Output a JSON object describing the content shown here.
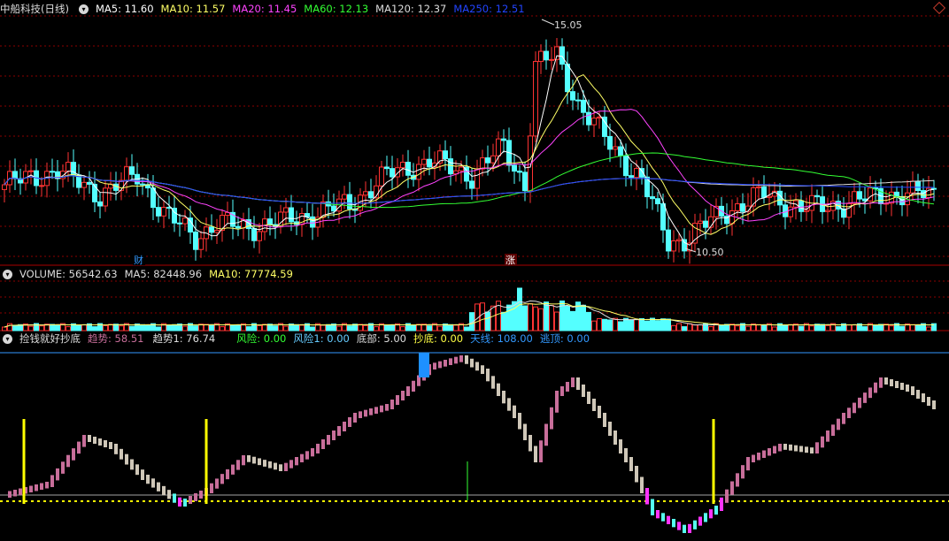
{
  "main_panel": {
    "stock_name": "中船科技",
    "period": "(日线)",
    "indicators": [
      {
        "label": "MA5: 11.60",
        "color": "#ffffff"
      },
      {
        "label": "MA10: 11.57",
        "color": "#ffff66"
      },
      {
        "label": "MA20: 11.45",
        "color": "#ff44ff"
      },
      {
        "label": "MA60: 12.13",
        "color": "#33ff33"
      },
      {
        "label": "MA120: 12.37",
        "color": "#dddddd"
      },
      {
        "label": "MA250: 12.51",
        "color": "#2244ff"
      }
    ],
    "high_label": "15.05",
    "low_label": "10.50",
    "event_markers": [
      "财",
      "涨"
    ]
  },
  "volume_panel": {
    "indicators": [
      {
        "label": "VOLUME: 56542.63",
        "color": "#dddddd"
      },
      {
        "label": "MA5: 82448.96",
        "color": "#dddddd"
      },
      {
        "label": "MA10: 77774.59",
        "color": "#ffff66"
      }
    ]
  },
  "signal_panel": {
    "name": "捡钱就好抄底",
    "indicators": [
      {
        "label": "趋势: 58.51",
        "color": "#c86e9a"
      },
      {
        "label": "趋势1: 76.74",
        "color": "#dddddd"
      },
      {
        "label": "风险: 0.00",
        "color": "#33ff33"
      },
      {
        "label": "风险1: 0.00",
        "color": "#66ccff"
      },
      {
        "label": "底部: 5.00",
        "color": "#dddddd"
      },
      {
        "label": "抄底: 0.00",
        "color": "#ffff44"
      },
      {
        "label": "天线: 108.00",
        "color": "#3399ff"
      },
      {
        "label": "逃顶: 0.00",
        "color": "#3399ff"
      }
    ]
  },
  "colors": {
    "up": "#ff3333",
    "down": "#54ffff",
    "grid": "#8b0000",
    "divider": "#aa0000"
  }
}
